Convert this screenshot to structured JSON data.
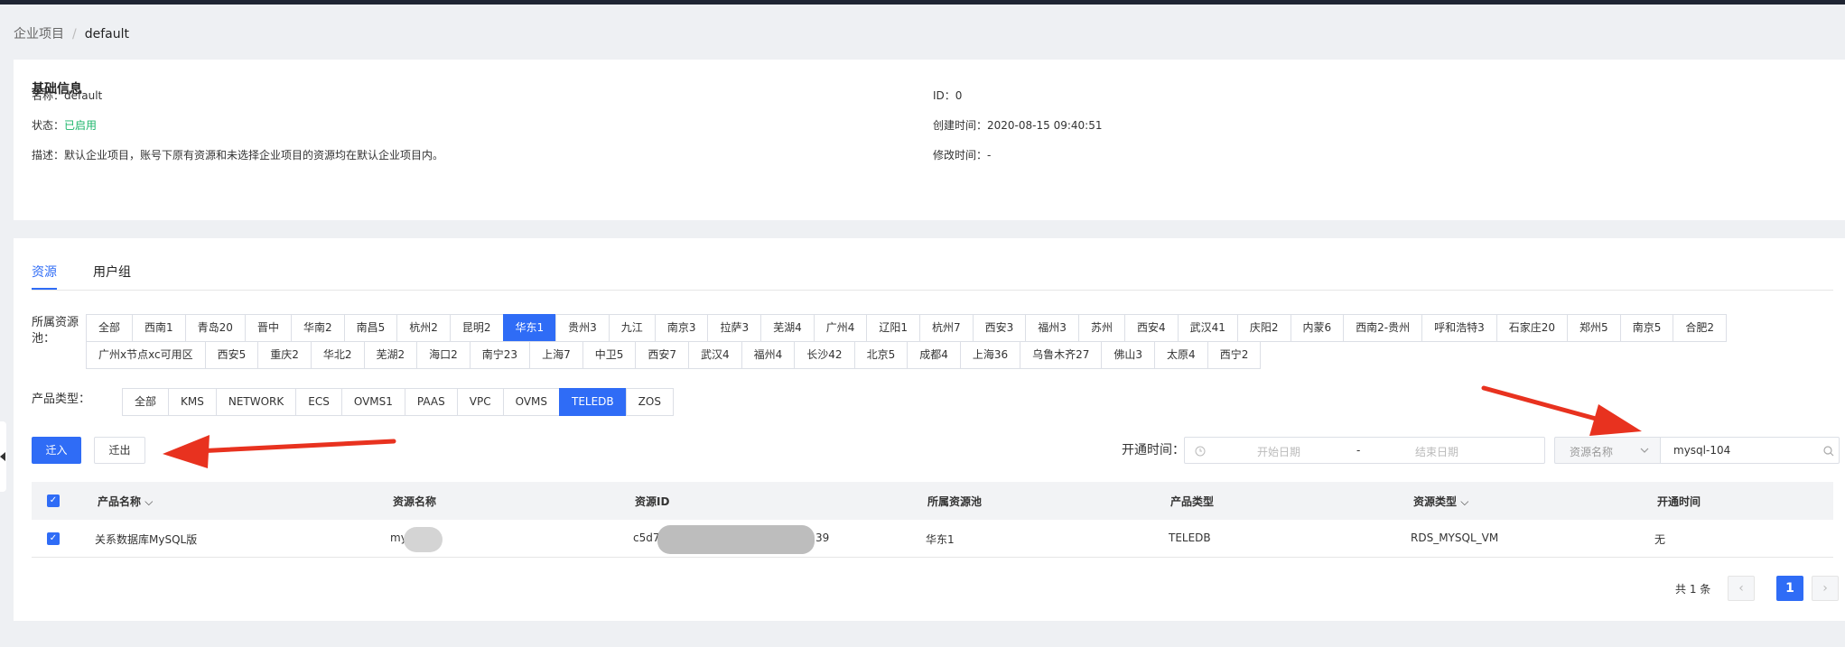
{
  "breadcrumb": {
    "parent": "企业项目",
    "separator": "/",
    "current": "default"
  },
  "basic_info": {
    "title": "基础信息",
    "name_label": "名称：",
    "name_value": "default",
    "status_label": "状态：",
    "status_value": "已启用",
    "desc_label": "描述：",
    "desc_value": "默认企业项目，账号下原有资源和未选择企业项目的资源均在默认企业项目内。",
    "id_label": "ID：",
    "id_value": "0",
    "created_label": "创建时间：",
    "created_value": "2020-08-15 09:40:51",
    "modified_label": "修改时间：",
    "modified_value": "-"
  },
  "tabs": [
    {
      "label": "资源"
    },
    {
      "label": "用户组"
    }
  ],
  "pool_filter": {
    "label_line1": "所属资源",
    "label_line2": "池：",
    "row1": [
      "全部",
      "西南1",
      "青岛20",
      "晋中",
      "华南2",
      "南昌5",
      "杭州2",
      "昆明2",
      "华东1",
      "贵州3",
      "九江",
      "南京3",
      "拉萨3",
      "芜湖4",
      "广州4",
      "辽阳1",
      "杭州7",
      "西安3",
      "福州3",
      "苏州",
      "西安4",
      "武汉41",
      "庆阳2",
      "内蒙6",
      "西南2-贵州",
      "呼和浩特3",
      "石家庄20",
      "郑州5",
      "南京5",
      "合肥2"
    ],
    "row2": [
      "广州x节点xc可用区",
      "西安5",
      "重庆2",
      "华北2",
      "芜湖2",
      "海口2",
      "南宁23",
      "上海7",
      "中卫5",
      "西安7",
      "武汉4",
      "福州4",
      "长沙42",
      "北京5",
      "成都4",
      "上海36",
      "乌鲁木齐27",
      "佛山3",
      "太原4",
      "西宁2"
    ],
    "selected": "华东1"
  },
  "product_filter": {
    "label": "产品类型：",
    "options": [
      "全部",
      "KMS",
      "NETWORK",
      "ECS",
      "OVMS1",
      "PAAS",
      "VPC",
      "OVMS",
      "TELEDB",
      "ZOS"
    ],
    "selected": "TELEDB"
  },
  "actions": {
    "move_in": "迁入",
    "move_out": "迁出"
  },
  "search": {
    "date_label": "开通时间：",
    "start_placeholder": "开始日期",
    "date_sep": "-",
    "end_placeholder": "结束日期",
    "field_select": "资源名称",
    "query": "mysql-104"
  },
  "table": {
    "columns": [
      "产品名称",
      "资源名称",
      "资源ID",
      "所属资源池",
      "产品类型",
      "资源类型",
      "开通时间"
    ],
    "rows": [
      {
        "product": "关系数据库MySQL版",
        "name": "my",
        "id_start": "c5d7",
        "id_end": "39",
        "pool": "华东1",
        "type": "TELEDB",
        "resource_type": "RDS_MYSQL_VM",
        "open_time": "无"
      }
    ]
  },
  "pagination": {
    "total": "共 1 条",
    "current": "1",
    "prev": "‹",
    "next": "›"
  },
  "colors": {
    "primary": "#2f6cf6",
    "success": "#1bb56a",
    "annotation_arrow": "#e8321f"
  }
}
